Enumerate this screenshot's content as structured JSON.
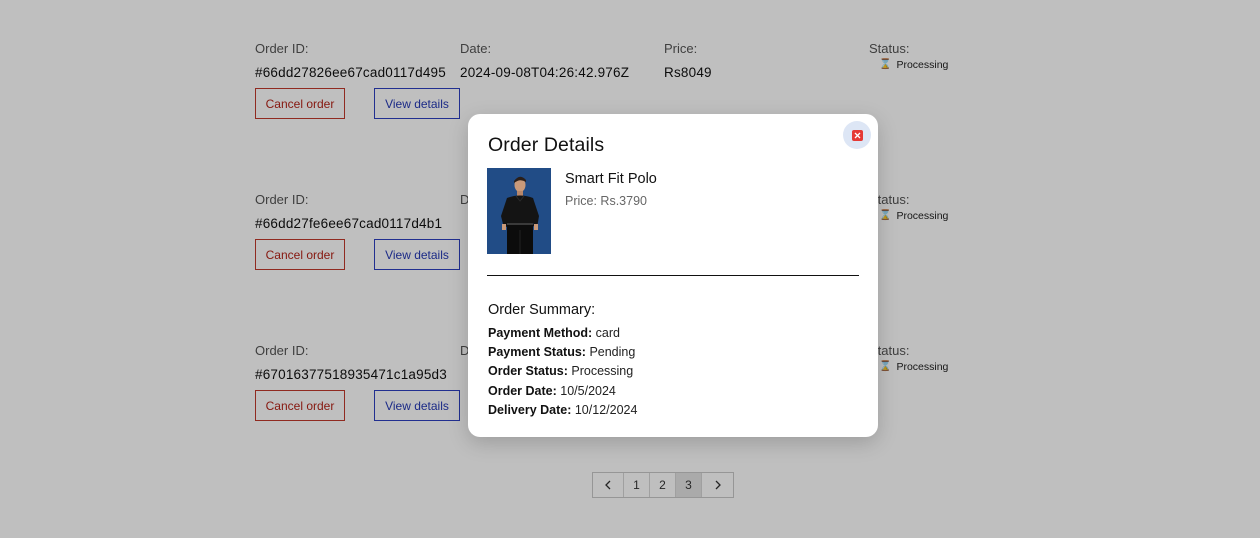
{
  "orders": [
    {
      "id_label": "Order ID:",
      "id": "#66dd27826ee67cad0117d495",
      "date_label": "Date:",
      "date": "2024-09-08T04:26:42.976Z",
      "price_label": "Price:",
      "price": "Rs8049",
      "status_label": "Status:",
      "status": "Processing",
      "cancel_label": "Cancel order",
      "view_label": "View details"
    },
    {
      "id_label": "Order ID:",
      "id": "#66dd27fe6ee67cad0117d4b1",
      "date_label": "Date:",
      "date": "",
      "price_label": "",
      "price": "",
      "status_label": "Status:",
      "status": "Processing",
      "cancel_label": "Cancel order",
      "view_label": "View details"
    },
    {
      "id_label": "Order ID:",
      "id": "#67016377518935471c1a95d3",
      "date_label": "Date:",
      "date": "",
      "price_label": "",
      "price": "",
      "status_label": "Status:",
      "status": "Processing",
      "cancel_label": "Cancel order",
      "view_label": "View details"
    }
  ],
  "icons": {
    "status": "hourglass-icon",
    "prev": "chevron-left-icon",
    "next": "chevron-right-icon",
    "close": "close-icon"
  },
  "pagination": {
    "prev": "‹",
    "pages": [
      "1",
      "2",
      "3"
    ],
    "current": "3",
    "next": "›"
  },
  "modal": {
    "title": "Order Details",
    "product": {
      "name": "Smart Fit Polo",
      "price": "Price: Rs.3790"
    },
    "summary_title": "Order Summary:",
    "summary": [
      {
        "key": "Payment Method:",
        "value": "card"
      },
      {
        "key": "Payment Status:",
        "value": "Pending"
      },
      {
        "key": "Order Status:",
        "value": "Processing"
      },
      {
        "key": "Order Date:",
        "value": "10/5/2024"
      },
      {
        "key": "Delivery Date:",
        "value": "10/12/2024"
      }
    ]
  },
  "colors": {
    "cancel": "#b42318",
    "view": "#2438b4",
    "close_bg": "#dde6f5",
    "close_icon": "#e53935"
  }
}
